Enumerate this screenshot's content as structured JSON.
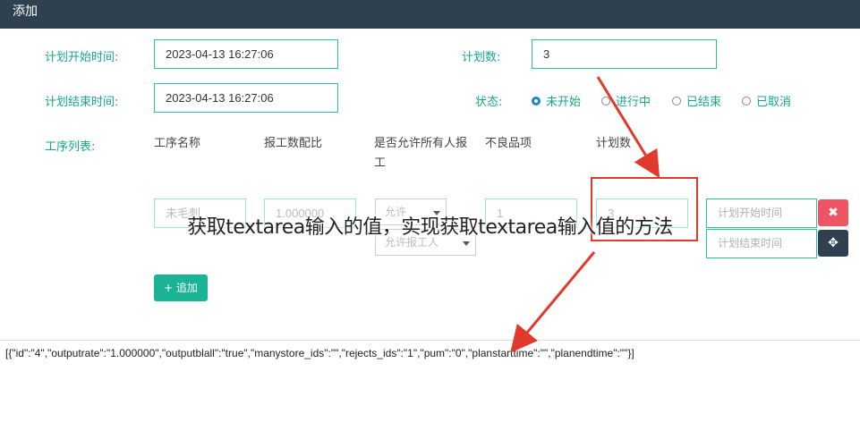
{
  "dialog": {
    "title": "添加"
  },
  "form": {
    "plan_start_label": "计划开始时间:",
    "plan_start_value": "2023-04-13 16:27:06",
    "plan_end_label": "计划结束时间:",
    "plan_end_value": "2023-04-13 16:27:06",
    "plan_count_label": "计划数:",
    "plan_count_value": "3",
    "status_label": "状态:",
    "status_options": [
      "未开始",
      "进行中",
      "已结束",
      "已取消"
    ],
    "status_selected": "未开始"
  },
  "process_table": {
    "label": "工序列表:",
    "headers": [
      "工序名称",
      "报工数配比",
      "是否允许所有人报工",
      "不良品项",
      "计划数"
    ],
    "row": {
      "process_name": "未毛刺",
      "ratio": "1.000000",
      "allow_select": "允许",
      "allow_sub": "允许报工人",
      "rejects": "1",
      "plan_count": "3",
      "start_placeholder": "计划开始时间",
      "end_placeholder": "计划结束时间"
    },
    "add_button": "+ 追加"
  },
  "result_text": "[{\"id\":\"4\",\"outputrate\":\"1.000000\",\"outputblall\":\"true\",\"manystore_ids\":\"\",\"rejects_ids\":\"1\",\"pum\":\"0\",\"planstarttime\":\"\",\"planendtime\":\"\"}]",
  "overlay_caption": "获取textarea输入的值，实现获取textarea输入值的方法",
  "icons": {
    "delete": "close-icon",
    "move": "move-icon",
    "add": "plus-icon"
  },
  "colors": {
    "accent": "#18a689",
    "titlebar": "#2f4050",
    "delete": "#ed5565",
    "move": "#2f4050",
    "annotation": "#e03a2a"
  }
}
